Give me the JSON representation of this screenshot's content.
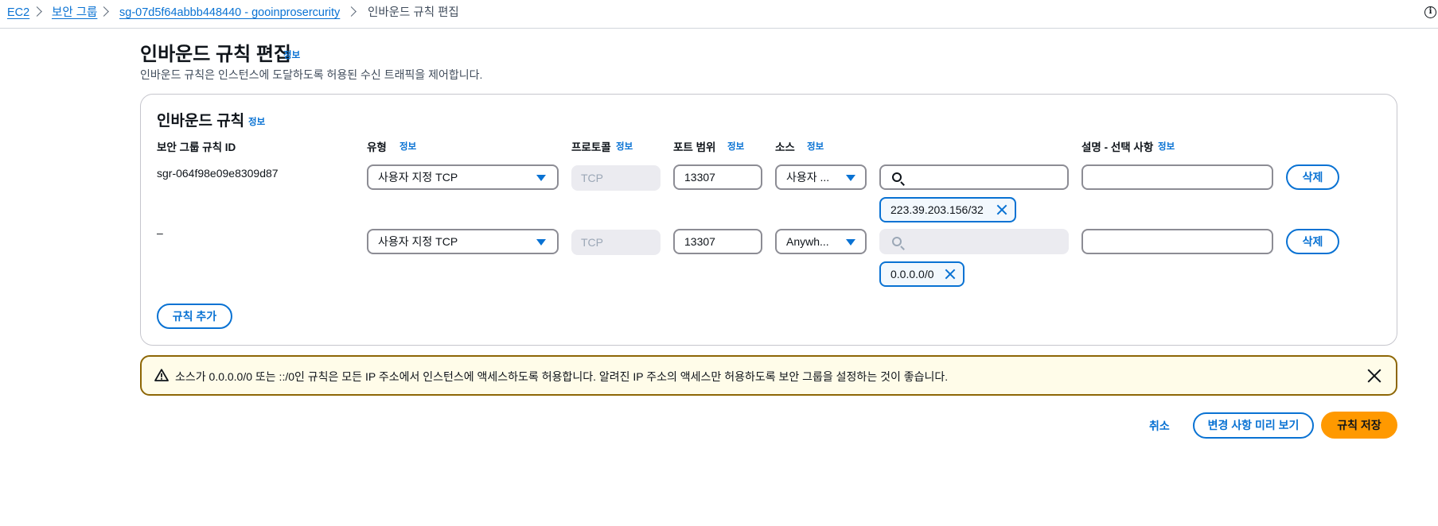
{
  "breadcrumb": {
    "items": [
      "EC2",
      "보안 그룹",
      "sg-07d5f64abbb448440 - gooinprosercurity",
      "인바운드 규칙 편집"
    ]
  },
  "header": {
    "title": "인바운드 규칙 편집",
    "info_label": "정보",
    "description": "인바운드 규칙은 인스턴스에 도달하도록 허용된 수신 트래픽을 제어합니다."
  },
  "rules_section": {
    "title": "인바운드 규칙",
    "info_label": "정보",
    "columns": {
      "rule_id": "보안 그룹 규칙 ID",
      "type": "유형",
      "protocol": "프로토콜",
      "port_range": "포트 범위",
      "source": "소스",
      "description": "설명 - 선택 사항"
    },
    "rules": [
      {
        "rule_id": "sgr-064f98e09e8309d87",
        "type": "사용자 지정 TCP",
        "protocol": "TCP",
        "port_range": "13307",
        "source_type": "사용자 ...",
        "source_search": "",
        "source_token": "223.39.203.156/32",
        "description": "",
        "delete_label": "삭제"
      },
      {
        "rule_id": "–",
        "type": "사용자 지정 TCP",
        "protocol": "TCP",
        "port_range": "13307",
        "source_type": "Anywh...",
        "source_search": "",
        "source_token": "0.0.0.0/0",
        "description": "",
        "delete_label": "삭제"
      }
    ],
    "add_rule_label": "규칙 추가"
  },
  "alert": {
    "message": "소스가 0.0.0.0/0 또는 ::/0인 규칙은 모든 IP 주소에서 인스턴스에 액세스하도록 허용합니다. 알려진 IP 주소의 액세스만 허용하도록 보안 그룹을 설정하는 것이 좋습니다."
  },
  "footer": {
    "cancel_label": "취소",
    "preview_label": "변경 사항 미리 보기",
    "save_label": "규칙 저장"
  },
  "colors": {
    "link": "#0972d3",
    "primary_button": "#ff9900",
    "warning_border": "#8d6605",
    "warning_bg": "#fffce9"
  }
}
